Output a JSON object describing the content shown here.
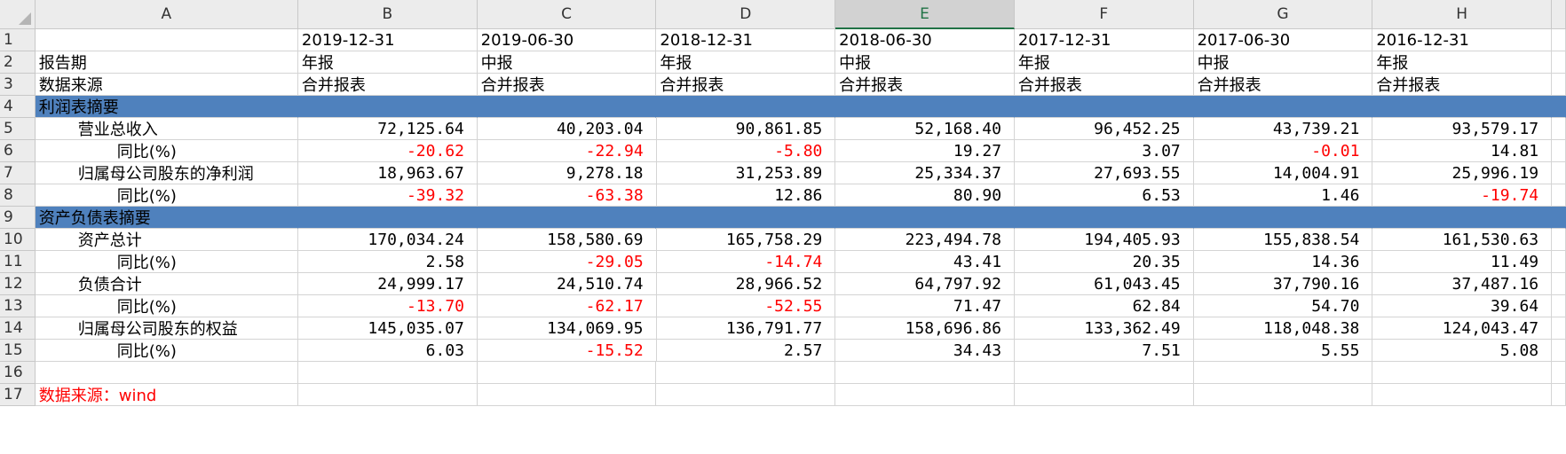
{
  "columns": [
    "A",
    "B",
    "C",
    "D",
    "E",
    "F",
    "G",
    "H"
  ],
  "selected_column": "E",
  "row_numbers": [
    "1",
    "2",
    "3",
    "4",
    "5",
    "6",
    "7",
    "8",
    "9",
    "10",
    "11",
    "12",
    "13",
    "14",
    "15",
    "16",
    "17"
  ],
  "header_rows": {
    "dates": [
      "",
      "2019-12-31",
      "2019-06-30",
      "2018-12-31",
      "2018-06-30",
      "2017-12-31",
      "2017-06-30",
      "2016-12-31"
    ],
    "report_period": [
      "报告期",
      "年报",
      "中报",
      "年报",
      "中报",
      "年报",
      "中报",
      "年报"
    ],
    "data_source": [
      "数据来源",
      "合并报表",
      "合并报表",
      "合并报表",
      "合并报表",
      "合并报表",
      "合并报表",
      "合并报表"
    ]
  },
  "sections": {
    "income": "利润表摘要",
    "balance": "资产负债表摘要"
  },
  "rows": {
    "revenue": {
      "label": "营业总收入",
      "values": [
        "72,125.64",
        "40,203.04",
        "90,861.85",
        "52,168.40",
        "96,452.25",
        "43,739.21",
        "93,579.17"
      ]
    },
    "revenue_yoy": {
      "label": "同比(%)",
      "values": [
        "-20.62",
        "-22.94",
        "-5.80",
        "19.27",
        "3.07",
        "-0.01",
        "14.81"
      ]
    },
    "net_profit": {
      "label": "归属母公司股东的净利润",
      "values": [
        "18,963.67",
        "9,278.18",
        "31,253.89",
        "25,334.37",
        "27,693.55",
        "14,004.91",
        "25,996.19"
      ]
    },
    "net_profit_yoy": {
      "label": "同比(%)",
      "values": [
        "-39.32",
        "-63.38",
        "12.86",
        "80.90",
        "6.53",
        "1.46",
        "-19.74"
      ]
    },
    "total_assets": {
      "label": "资产总计",
      "values": [
        "170,034.24",
        "158,580.69",
        "165,758.29",
        "223,494.78",
        "194,405.93",
        "155,838.54",
        "161,530.63"
      ]
    },
    "total_assets_yoy": {
      "label": "同比(%)",
      "values": [
        "2.58",
        "-29.05",
        "-14.74",
        "43.41",
        "20.35",
        "14.36",
        "11.49"
      ]
    },
    "total_liabilities": {
      "label": "负债合计",
      "values": [
        "24,999.17",
        "24,510.74",
        "28,966.52",
        "64,797.92",
        "61,043.45",
        "37,790.16",
        "37,487.16"
      ]
    },
    "total_liabilities_yoy": {
      "label": "同比(%)",
      "values": [
        "-13.70",
        "-62.17",
        "-52.55",
        "71.47",
        "62.84",
        "54.70",
        "39.64"
      ]
    },
    "equity": {
      "label": "归属母公司股东的权益",
      "values": [
        "145,035.07",
        "134,069.95",
        "136,791.77",
        "158,696.86",
        "133,362.49",
        "118,048.38",
        "124,043.47"
      ]
    },
    "equity_yoy": {
      "label": "同比(%)",
      "values": [
        "6.03",
        "-15.52",
        "2.57",
        "34.43",
        "7.51",
        "5.55",
        "5.08"
      ]
    }
  },
  "footnote": "数据来源：wind",
  "colors": {
    "section_fill": "#4f81bd",
    "negative": "#ff0000",
    "header_bg": "#ececec",
    "selected_accent": "#217346"
  }
}
